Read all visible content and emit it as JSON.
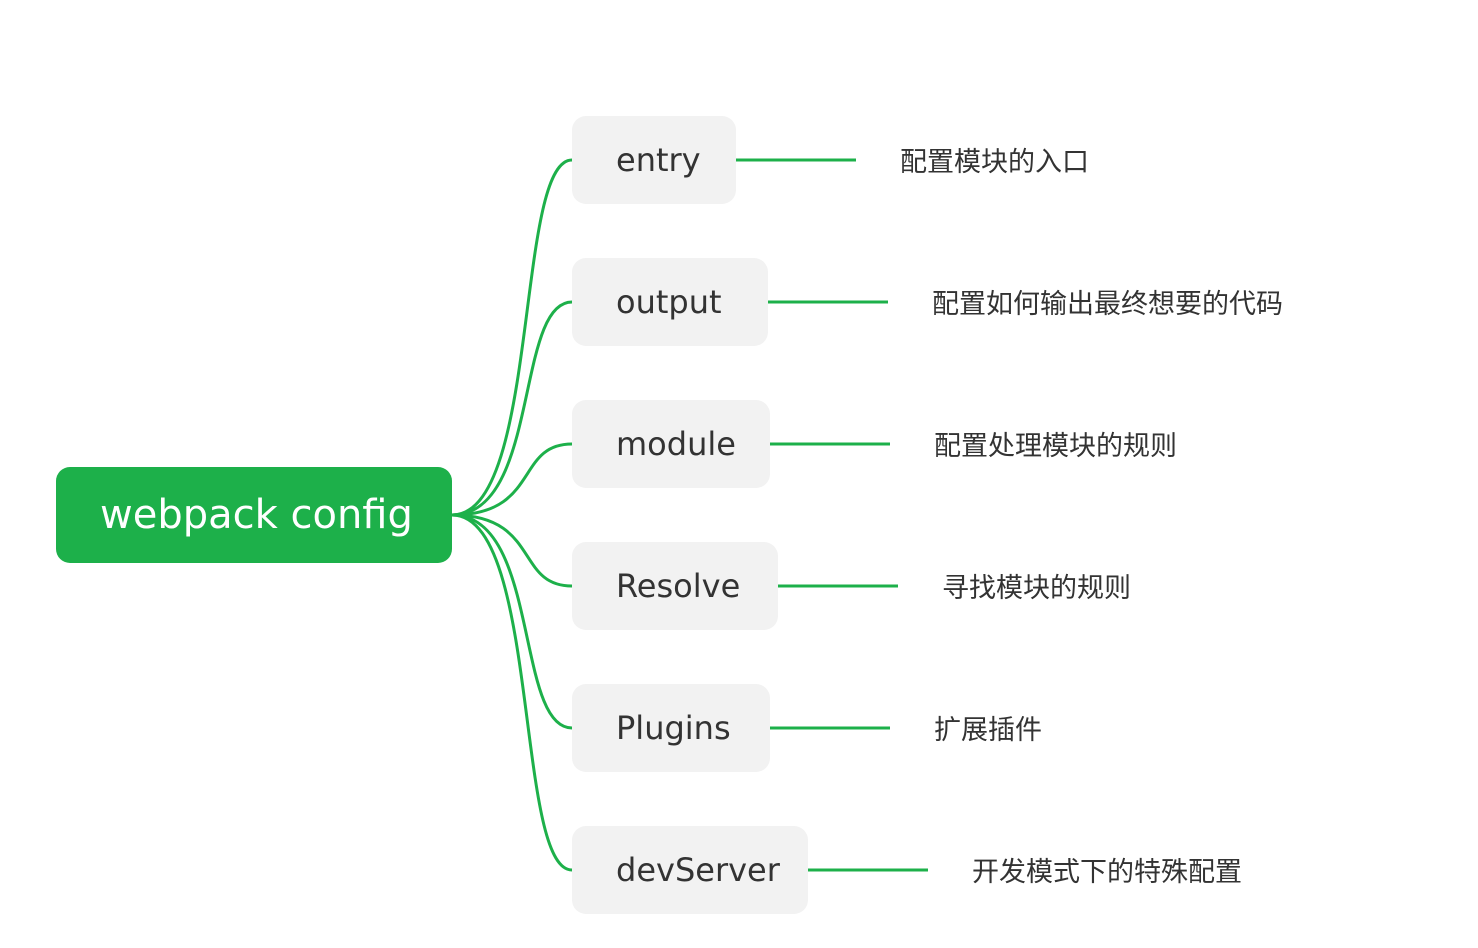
{
  "diagram": {
    "root": {
      "label": "webpack config"
    },
    "branches": [
      {
        "key": "entry",
        "label": "entry",
        "description": "配置模块的入口"
      },
      {
        "key": "output",
        "label": "output",
        "description": "配置如何输出最终想要的代码"
      },
      {
        "key": "module",
        "label": "module",
        "description": "配置处理模块的规则"
      },
      {
        "key": "resolve",
        "label": "Resolve",
        "description": "寻找模块的规则"
      },
      {
        "key": "plugins",
        "label": "Plugins",
        "description": "扩展插件"
      },
      {
        "key": "devserver",
        "label": "devServer",
        "description": "开发模式下的特殊配置"
      }
    ]
  },
  "colors": {
    "accent": "#1db04a",
    "node_background": "#f2f2f2",
    "text": "#333333",
    "root_text": "#ffffff"
  }
}
